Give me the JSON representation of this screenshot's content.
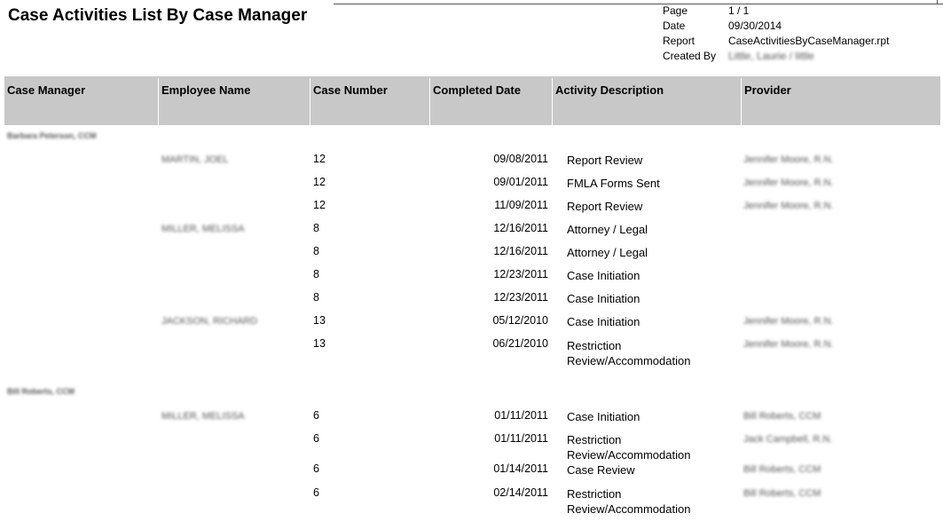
{
  "report": {
    "title": "Case Activities List By Case Manager",
    "meta": [
      {
        "label": "Page",
        "value": "1  /  1"
      },
      {
        "label": "Date",
        "value": "09/30/2014"
      },
      {
        "label": "Report",
        "value": "CaseActivitiesByCaseManager.rpt"
      },
      {
        "label": "Created By",
        "value": "Little, Laurie / little"
      }
    ]
  },
  "columns": [
    "Case Manager",
    "Employee Name",
    "Case Number",
    "Completed Date",
    "Activity Description",
    "Provider"
  ],
  "groups": [
    {
      "case_manager": "Barbara Peterson, CCM",
      "rows": [
        {
          "employee": "MARTIN, JOEL",
          "case_number": "12",
          "date": "09/08/2011",
          "activity": "Report Review",
          "provider": "Jennifer Moore, R.N."
        },
        {
          "employee": "",
          "case_number": "12",
          "date": "09/01/2011",
          "activity": "FMLA Forms Sent",
          "provider": "Jennifer Moore, R.N."
        },
        {
          "employee": "",
          "case_number": "12",
          "date": "11/09/2011",
          "activity": "Report Review",
          "provider": "Jennifer Moore, R.N."
        },
        {
          "employee": "MILLER, MELISSA",
          "case_number": "8",
          "date": "12/16/2011",
          "activity": "Attorney / Legal",
          "provider": ""
        },
        {
          "employee": "",
          "case_number": "8",
          "date": "12/16/2011",
          "activity": "Attorney / Legal",
          "provider": ""
        },
        {
          "employee": "",
          "case_number": "8",
          "date": "12/23/2011",
          "activity": "Case Initiation",
          "provider": ""
        },
        {
          "employee": "",
          "case_number": "8",
          "date": "12/23/2011",
          "activity": "Case Initiation",
          "provider": ""
        },
        {
          "employee": "JACKSON, RICHARD",
          "case_number": "13",
          "date": "05/12/2010",
          "activity": "Case Initiation",
          "provider": "Jennifer Moore, R.N."
        },
        {
          "employee": "",
          "case_number": "13",
          "date": "06/21/2010",
          "activity": "Restriction",
          "activity2": "Review/Accommodation",
          "provider": "Jennifer Moore, R.N."
        }
      ]
    },
    {
      "case_manager": "Bill Roberts, CCM",
      "rows": [
        {
          "employee": "MILLER, MELISSA",
          "case_number": "6",
          "date": "01/11/2011",
          "activity": "Case Initiation",
          "provider": "Bill Roberts, CCM"
        },
        {
          "employee": "",
          "case_number": "6",
          "date": "01/11/2011",
          "activity": "Restriction",
          "activity2": "Review/Accommodation",
          "provider": "Jack Campbell, R.N."
        },
        {
          "employee": "",
          "case_number": "6",
          "date": "01/14/2011",
          "activity": "Case Review",
          "provider": "Bill Roberts, CCM"
        },
        {
          "employee": "",
          "case_number": "6",
          "date": "02/14/2011",
          "activity": "Restriction",
          "activity2": "Review/Accommodation",
          "provider": "Bill Roberts, CCM"
        }
      ]
    }
  ]
}
